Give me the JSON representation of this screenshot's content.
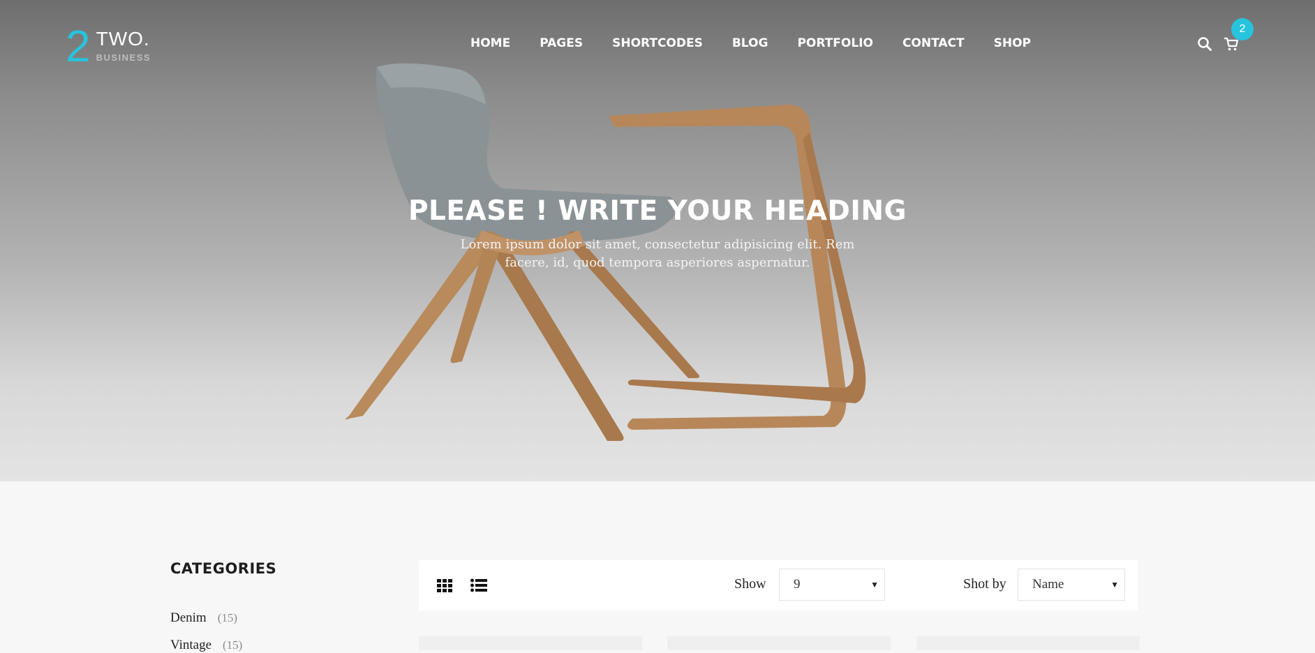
{
  "brand": {
    "number": "2",
    "name": "TWO.",
    "tagline": "BUSINESS",
    "accent_color": "#28c3dc"
  },
  "nav": {
    "items": [
      "HOME",
      "PAGES",
      "SHORTCODES",
      "BLOG",
      "PORTFOLIO",
      "CONTACT",
      "SHOP"
    ]
  },
  "header_icons": {
    "search": "search-icon",
    "cart": "cart-icon",
    "cart_count": "2"
  },
  "hero": {
    "title": "PLEASE ! WRITE YOUR HEADING",
    "subtitle": "Lorem ipsum dolor sit amet, consectetur adipisicing elit. Rem facere, id, quod tempora asperiores aspernatur."
  },
  "sidebar": {
    "title": "CATEGORIES",
    "categories": [
      {
        "label": "Denim",
        "count": "(15)"
      },
      {
        "label": "Vintage",
        "count": "(15)"
      }
    ]
  },
  "toolbar": {
    "view_icons": [
      "grid-icon",
      "list-icon"
    ],
    "show_label": "Show",
    "show_value": "9",
    "sort_label": "Shot by",
    "sort_value": "Name"
  }
}
